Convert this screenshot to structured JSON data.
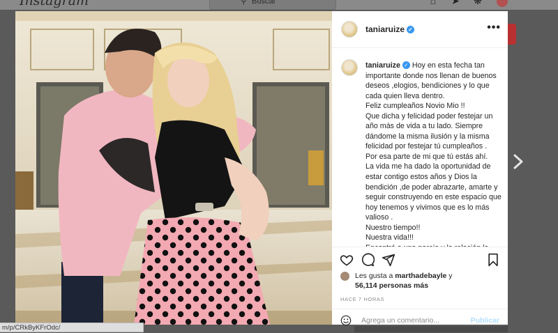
{
  "topbar": {
    "logo": "Instagram",
    "search_placeholder": "Buscar",
    "icons": [
      "home-icon",
      "messenger-icon",
      "explore-icon",
      "heart-icon",
      "profile-avatar"
    ]
  },
  "post": {
    "username": "taniaruize",
    "verified": true,
    "more_label": "•••",
    "caption": "Hoy en esta fecha tan importante donde nos llenan de buenos deseos ,elogios, bendiciones y lo que cada quien lleva dentro.\nFeliz cumpleaños Novio Mio !!\nQue dicha y felicidad poder festejar un año más de vida a tu lado. Siempre dándome la misma ilusión y la misma felicidad por festejar tú cumpleaños .\nPor esa parte de mi que tú estás ahí.\nLa vida me ha dado la oportunidad de estar contigo estos años y Dios la bendición ,de poder abrazarte, amarte y seguir construyendo en este espacio que hoy tenemos y vivimos que es lo más valioso .\nNuestro tiempo!!\nNuestra vida!!!\nEncontré a una pareja y la relación la",
    "likes_prefix": "Les gusta a",
    "likes_user": "marthadebayle",
    "likes_conj": "y",
    "likes_count": "56,114 personas más",
    "time_ago": "HACE 7 HORAS",
    "comment_placeholder": "Agrega un comentario...",
    "publish_label": "Publicar"
  },
  "status_url": "m/p/CRkByKFrOdc/",
  "colors": {
    "accent_blue": "#3897f0",
    "publish_disabled": "#b2dffc",
    "text": "#262626",
    "muted": "#8e8e8e",
    "overlay": "#5a5a5a"
  }
}
